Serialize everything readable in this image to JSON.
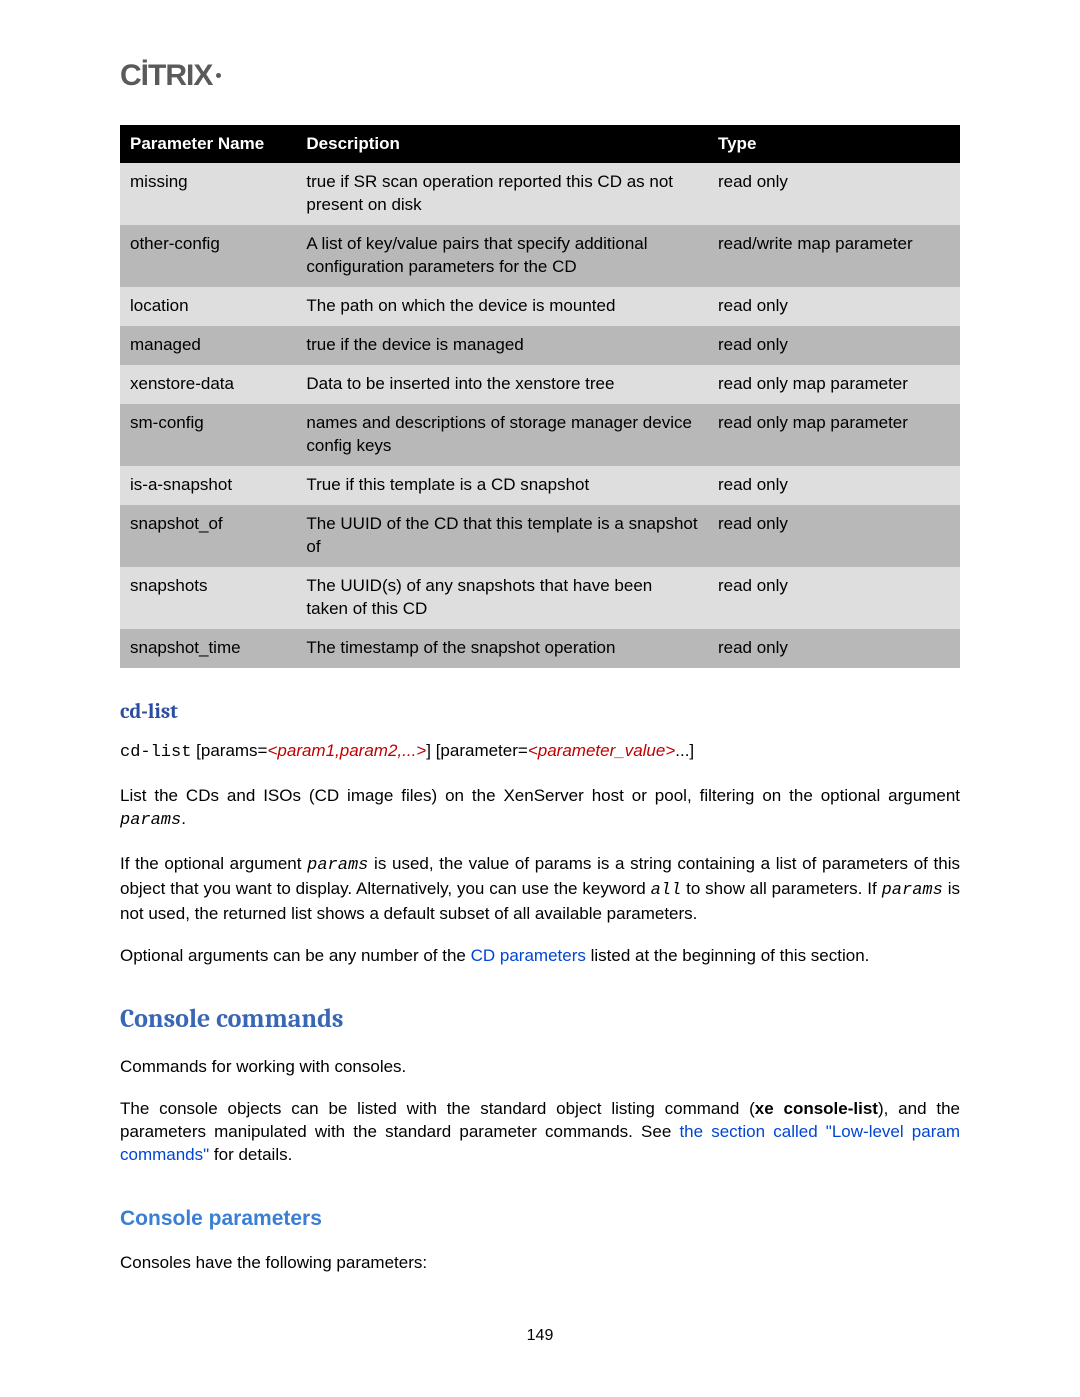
{
  "logo": "CİTRIX",
  "table": {
    "headers": [
      "Parameter Name",
      "Description",
      "Type"
    ],
    "rows": [
      {
        "name": "missing",
        "desc": "true if SR scan operation reported this CD as not present on disk",
        "type": "read only"
      },
      {
        "name": "other-config",
        "desc": "A list of key/value pairs that specify additional configuration parameters for the CD",
        "type": "read/write map parameter"
      },
      {
        "name": "location",
        "desc": "The path on which the device is mounted",
        "type": "read only"
      },
      {
        "name": "managed",
        "desc": "true if the device is managed",
        "type": "read only"
      },
      {
        "name": "xenstore-data",
        "desc": "Data to be inserted into the xenstore tree",
        "type": "read only map parameter"
      },
      {
        "name": "sm-config",
        "desc": "names and descriptions of storage manager device config keys",
        "type": "read only map parameter"
      },
      {
        "name": "is-a-snapshot",
        "desc": "True if this template is a CD snapshot",
        "type": "read only"
      },
      {
        "name": "snapshot_of",
        "desc": "The UUID of the CD that this template is a snapshot of",
        "type": "read only"
      },
      {
        "name": "snapshots",
        "desc": "The UUID(s) of any snapshots that have been taken of this CD",
        "type": "read only"
      },
      {
        "name": "snapshot_time",
        "desc": "The timestamp of the snapshot operation",
        "type": "read only"
      }
    ]
  },
  "cdlist": {
    "heading": "cd-list",
    "syntax_cmd": "cd-list",
    "syntax_mid1": " [params=",
    "syntax_red1": "<param1,param2,...>",
    "syntax_mid2": "] [parameter=",
    "syntax_red2": "<parameter_value>",
    "syntax_end": "...]",
    "p1_a": "List the CDs and ISOs (CD image files) on the XenServer host or pool, filtering on the optional argument ",
    "p1_code": "params",
    "p1_b": ".",
    "p2_a": "If the optional argument ",
    "p2_code1": "params",
    "p2_b": " is used, the value of params is a string containing a list of parameters of this object that you want to display. Alternatively, you can use the keyword ",
    "p2_code2": "all",
    "p2_c": " to show all parameters. If ",
    "p2_code3": "params",
    "p2_d": " is not used, the returned list shows a default subset of all available parameters.",
    "p3_a": "Optional arguments can be any number of the ",
    "p3_link": "CD parameters",
    "p3_b": " listed at the beginning of this section."
  },
  "console": {
    "heading": "Console commands",
    "p1": "Commands for working with consoles.",
    "p2_a": "The console objects can be listed with the standard object listing command (",
    "p2_bold": "xe console-list",
    "p2_b": "), and the parameters manipulated with the standard parameter commands. See ",
    "p2_link": "the section called \"Low-level param commands\"",
    "p2_c": " for details.",
    "params_heading": "Console parameters",
    "params_intro": "Consoles have the following parameters:"
  },
  "page_number": "149"
}
